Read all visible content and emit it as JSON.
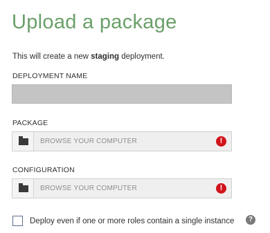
{
  "dialog": {
    "title": "Upload a package",
    "subtitle_prefix": "This will create a new ",
    "subtitle_emphasis": "staging",
    "subtitle_suffix": " deployment."
  },
  "fields": {
    "deployment_name": {
      "label": "DEPLOYMENT NAME",
      "value": ""
    },
    "package": {
      "label": "PACKAGE",
      "placeholder": "BROWSE YOUR COMPUTER",
      "folder_icon": "folder-icon",
      "error_icon": "error-icon",
      "error_glyph": "!"
    },
    "configuration": {
      "label": "CONFIGURATION",
      "placeholder": "BROWSE YOUR COMPUTER",
      "folder_icon": "folder-icon",
      "error_icon": "error-icon",
      "error_glyph": "!"
    }
  },
  "options": {
    "single_instance": {
      "label": "Deploy even if one or more roles contain a single instance",
      "checked": false,
      "help_glyph": "?"
    }
  },
  "colors": {
    "title": "#6aa06a",
    "error": "#d1141b",
    "input_fill": "#c4c4c4"
  }
}
